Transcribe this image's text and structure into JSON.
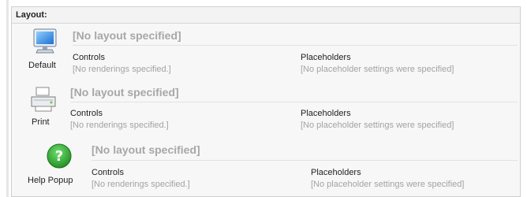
{
  "section": {
    "title": "Layout:"
  },
  "devices": [
    {
      "name": "Default",
      "icon": "monitor-icon",
      "layout": "[No layout specified]",
      "controls_label": "Controls",
      "controls_value": "[No renderings specified.]",
      "placeholders_label": "Placeholders",
      "placeholders_value": "[No placeholder settings were specified]"
    },
    {
      "name": "Print",
      "icon": "printer-icon",
      "layout": "[No layout specified]",
      "controls_label": "Controls",
      "controls_value": "[No renderings specified.]",
      "placeholders_label": "Placeholders",
      "placeholders_value": "[No placeholder settings were specified]"
    },
    {
      "name": "Help Popup",
      "icon": "help-icon",
      "layout": "[No layout specified]",
      "controls_label": "Controls",
      "controls_value": "[No renderings specified.]",
      "placeholders_label": "Placeholders",
      "placeholders_value": "[No placeholder settings were specified]"
    }
  ],
  "colors": {
    "help_green": "#2e9b2e",
    "muted_text": "#a3a3a3",
    "layout_title": "#a7a7a7"
  }
}
